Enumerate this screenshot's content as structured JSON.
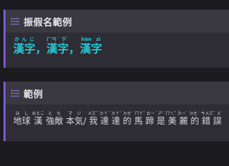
{
  "block1": {
    "title": "振假名範例",
    "items": [
      {
        "base": "漢字",
        "ruby": "かんじ"
      },
      {
        "sep": "，"
      },
      {
        "base": "漢字",
        "ruby": "ㄏㄢˋ ㄗˋ"
      },
      {
        "sep": "，"
      },
      {
        "base": "漢字",
        "ruby": "hàn zì"
      }
    ]
  },
  "block2": {
    "title": "範例",
    "items": [
      {
        "base": "地球",
        "ruby": "ほし"
      },
      {
        "sep": " "
      },
      {
        "base": "漢",
        "ruby": "おとこ"
      },
      {
        "sep": " "
      },
      {
        "base": "強敵",
        "ruby": "とも"
      },
      {
        "sep": " "
      },
      {
        "base": "本気",
        "ruby": "マジ"
      },
      {
        "sep": "/ "
      },
      {
        "base": "我達達的馬蹄是美麗的錯誤",
        "ruby": "ㄨㄛˇ ㄉㄚˊ ㄉㄚˊ ㄉㄜ˙ ㄇㄚˇ ㄊㄧˊ ㄕˋ ㄇㄟˇ ㄌㄧˋ ㄉㄜ˙ ㄘㄨㄛˋ ㄨˋ"
      }
    ]
  },
  "colors": {
    "accent": "#7b5cd6",
    "highlight_text": "#25c9d6",
    "header_bg": "#3a3840",
    "body_bg": "#2e2c34",
    "page_bg": "#1c1b20"
  },
  "icons": {
    "header": "list-icon"
  }
}
